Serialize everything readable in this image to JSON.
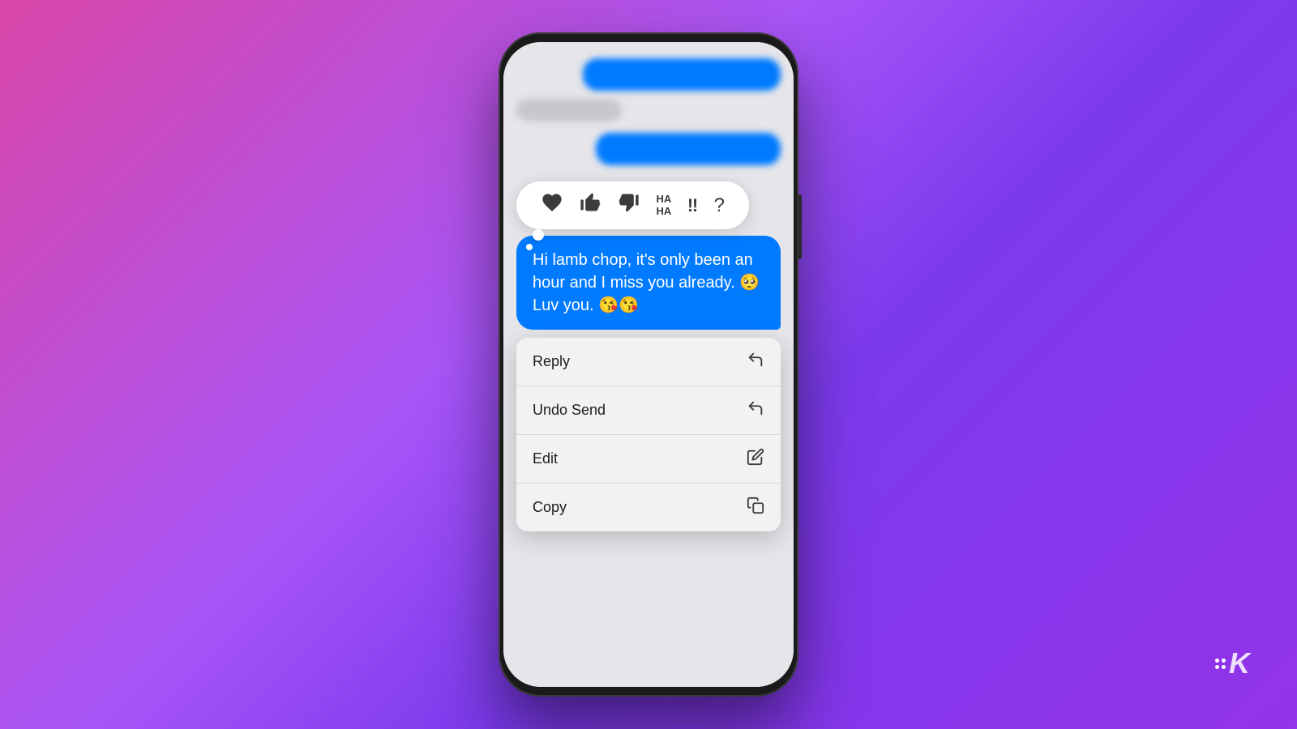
{
  "background": {
    "gradient": "purple-pink"
  },
  "phone": {
    "messages": {
      "blurred_1": "blurred message 1",
      "blurred_2": "blurred message 2",
      "blurred_3": "blurred message 3"
    },
    "reactions": {
      "items": [
        {
          "name": "heart",
          "emoji": "♥"
        },
        {
          "name": "thumbs-up",
          "emoji": "👍"
        },
        {
          "name": "thumbs-down",
          "emoji": "👎"
        },
        {
          "name": "haha",
          "text": "HA\nHA"
        },
        {
          "name": "exclaim",
          "text": "‼"
        },
        {
          "name": "question",
          "text": "?"
        }
      ]
    },
    "main_message": {
      "text": "Hi lamb chop, it's only been an hour and I miss you already. 🥺 Luv you. 😘😘"
    },
    "context_menu": {
      "items": [
        {
          "label": "Reply",
          "icon": "↩",
          "id": "reply"
        },
        {
          "label": "Undo Send",
          "icon": "↩",
          "id": "undo-send"
        },
        {
          "label": "Edit",
          "icon": "✏",
          "id": "edit"
        },
        {
          "label": "Copy",
          "icon": "⧉",
          "id": "copy"
        }
      ]
    }
  },
  "watermark": {
    "text": "K",
    "prefix": "·K"
  }
}
